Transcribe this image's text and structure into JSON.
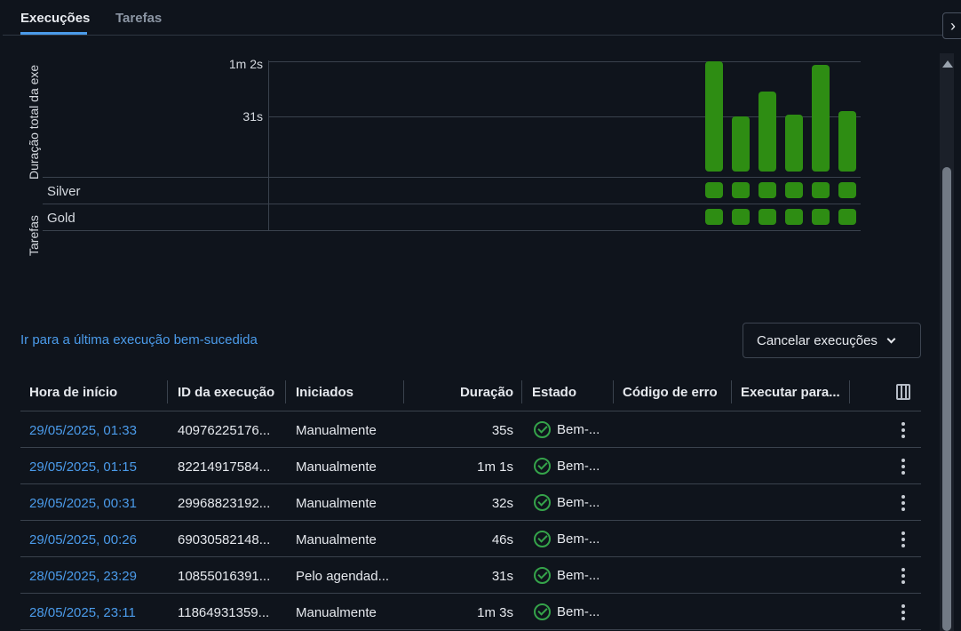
{
  "tabs": [
    {
      "label": "Execuções",
      "active": true
    },
    {
      "label": "Tarefas",
      "active": false
    }
  ],
  "chart_data": {
    "type": "bar",
    "ylabel": "Duração total da exe",
    "ytick_labels": [
      "1m 2s",
      "31s"
    ],
    "values_seconds": [
      62,
      31,
      45,
      32,
      60,
      34
    ],
    "tasks_label": "Tarefas",
    "tasks": [
      {
        "name": "Silver",
        "status": [
          "success",
          "success",
          "success",
          "success",
          "success",
          "success"
        ]
      },
      {
        "name": "Gold",
        "status": [
          "success",
          "success",
          "success",
          "success",
          "success",
          "success"
        ]
      }
    ],
    "bar_color": "#2e8d13"
  },
  "links": {
    "last_success": "Ir para a última execução bem-sucedida"
  },
  "cancel_button": {
    "label": "Cancelar execuções"
  },
  "table": {
    "headers": [
      "Hora de início",
      "ID da execução",
      "Iniciados",
      "Duração",
      "Estado",
      "Código de erro",
      "Executar para..."
    ],
    "rows": [
      {
        "start": "29/05/2025, 01:33",
        "run_id": "40976225176...",
        "trigger": "Manualmente",
        "duration": "35s",
        "state": "Bem-..."
      },
      {
        "start": "29/05/2025, 01:15",
        "run_id": "82214917584...",
        "trigger": "Manualmente",
        "duration": "1m 1s",
        "state": "Bem-..."
      },
      {
        "start": "29/05/2025, 00:31",
        "run_id": "29968823192...",
        "trigger": "Manualmente",
        "duration": "32s",
        "state": "Bem-..."
      },
      {
        "start": "29/05/2025, 00:26",
        "run_id": "69030582148...",
        "trigger": "Manualmente",
        "duration": "46s",
        "state": "Bem-..."
      },
      {
        "start": "28/05/2025, 23:29",
        "run_id": "10855016391...",
        "trigger": "Pelo agendad...",
        "duration": "31s",
        "state": "Bem-..."
      },
      {
        "start": "28/05/2025, 23:11",
        "run_id": "11864931359...",
        "trigger": "Manualmente",
        "duration": "1m 3s",
        "state": "Bem-..."
      }
    ]
  },
  "colors": {
    "accent": "#4b9bea",
    "success": "#35a34a",
    "background": "#0f141c"
  }
}
